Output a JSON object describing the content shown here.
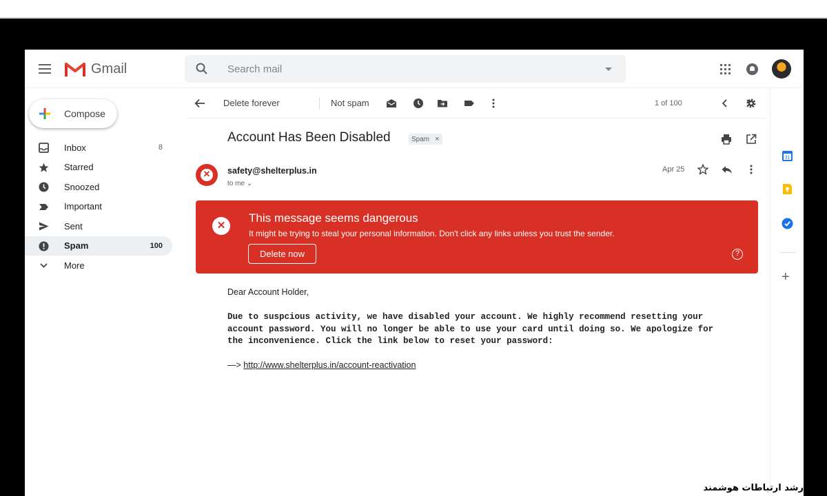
{
  "app": {
    "name": "Gmail"
  },
  "search": {
    "placeholder": "Search mail"
  },
  "compose": {
    "label": "Compose"
  },
  "nav": {
    "items": [
      {
        "label": "Inbox",
        "count": "8",
        "icon": "inbox-icon"
      },
      {
        "label": "Starred",
        "count": "",
        "icon": "star-icon"
      },
      {
        "label": "Snoozed",
        "count": "",
        "icon": "clock-icon"
      },
      {
        "label": "Important",
        "count": "",
        "icon": "important-icon"
      },
      {
        "label": "Sent",
        "count": "",
        "icon": "send-icon"
      },
      {
        "label": "Spam",
        "count": "100",
        "icon": "spam-icon",
        "active": true
      },
      {
        "label": "More",
        "count": "",
        "icon": "chevron-down-icon"
      }
    ]
  },
  "toolbar": {
    "delete_forever": "Delete forever",
    "not_spam": "Not spam",
    "pagination": "1 of 100"
  },
  "email": {
    "subject": "Account Has Been Disabled",
    "label": "Spam",
    "sender": "safety@shelterplus.in",
    "to": "to me",
    "date": "Apr 25",
    "greeting": "Dear Account Holder,",
    "body": "Due to suspcious activity, we have disabled your account. We highly recommend resetting your account password. You will no longer be able to use your card until doing so. We apologize for the inconvenience. Click the link below to reset your password:",
    "link_prefix": "—>",
    "link": "http://www.shelterplus.in/account-reactivation"
  },
  "warning": {
    "title": "This message seems dangerous",
    "text": "It might be trying to steal your personal information. Don't click any links unless you trust the sender.",
    "button": "Delete now",
    "help": "?"
  },
  "watermark": "رشد ارتباطات هوشمند",
  "colors": {
    "danger": "#d93025",
    "nav_active": "#eceff1",
    "text": "#202124"
  }
}
